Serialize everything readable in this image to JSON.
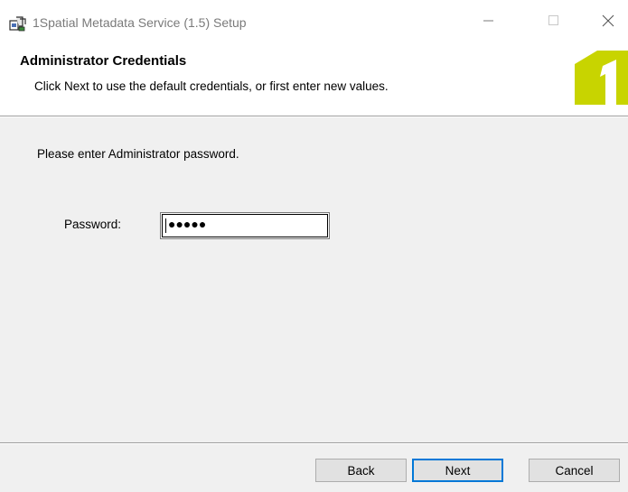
{
  "window": {
    "title": "1Spatial Metadata Service (1.5) Setup",
    "icons": {
      "app": "installer-icon",
      "minimize": "minimize-icon",
      "maximize": "maximize-icon",
      "close": "close-icon"
    }
  },
  "header": {
    "title": "Administrator Credentials",
    "subtitle": "Click Next to use the default credentials, or first enter new values.",
    "logo_icon": "1spatial-logo-icon",
    "logo_color": "#c8d400"
  },
  "body": {
    "prompt": "Please enter Administrator password.",
    "password_label": "Password:",
    "password_masked": "●●●●●"
  },
  "footer": {
    "back_label": "Back",
    "next_label": "Next",
    "cancel_label": "Cancel",
    "accent_color": "#0078d7"
  }
}
